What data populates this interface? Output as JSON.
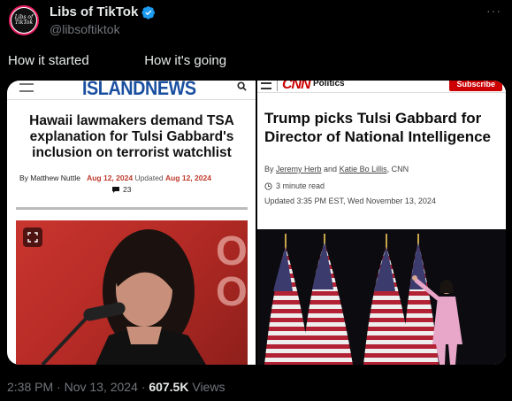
{
  "author": {
    "display_name": "Libs of TikTok",
    "handle": "@libsoftiktok",
    "avatar_text": "Libs of TikTok"
  },
  "tweet": {
    "text": "How it started               How it's going",
    "timestamp": "2:38 PM · Nov 13, 2024 · ",
    "views": "607.5K",
    "views_label": " Views"
  },
  "left_article": {
    "site_name": "ISLANDNEWS",
    "headline": "Hawaii lawmakers demand TSA explanation for Tulsi Gabbard's inclusion on terrorist watchlist",
    "by": "By Matthew Nuttle",
    "published_date": "Aug 12, 2024",
    "updated_label": "Updated",
    "updated_date": "Aug 12, 2024",
    "comments": "23",
    "photo_text": "O\nO"
  },
  "right_article": {
    "logo": "CNN",
    "section": "Politics",
    "subscribe": "Subscribe",
    "headline": "Trump picks Tulsi Gabbard for Director of National Intelligence",
    "by_prefix": "By ",
    "author1": "Jeremy Herb",
    "and": " and ",
    "author2": "Katie Bo Lillis",
    "outlet": ", CNN",
    "read_time": "3 minute read",
    "updated": "Updated 3:35 PM EST, Wed November 13, 2024"
  },
  "colors": {
    "background": "#000000",
    "verified": "#1d9bf0",
    "island_blue": "#1a4fa0",
    "cnn_red": "#cc0000",
    "date_red": "#c0392b"
  },
  "icons": [
    "verified-badge-icon",
    "more-icon",
    "menu-icon",
    "search-icon",
    "comment-icon",
    "clock-icon",
    "expand-icon"
  ]
}
